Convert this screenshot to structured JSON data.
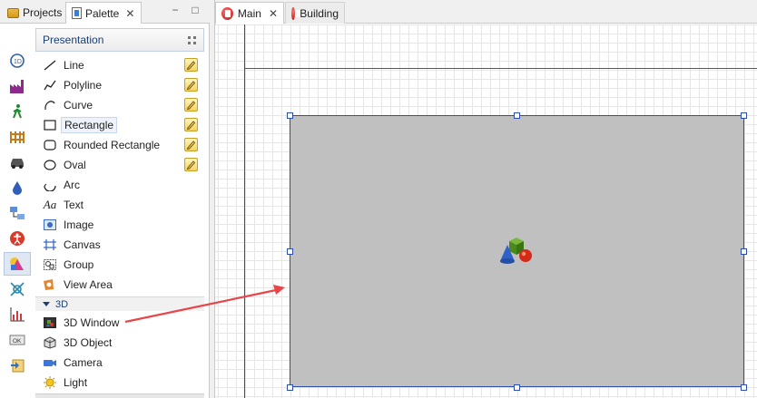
{
  "left_view": {
    "tabs": [
      {
        "label": "Projects",
        "icon": "projects-icon"
      },
      {
        "label": "Palette",
        "icon": "palette-icon",
        "close": "✕"
      }
    ],
    "minimize": "−",
    "maximize": "□"
  },
  "categories": [
    {
      "name": "statechart",
      "icon": "statechart-icon"
    },
    {
      "name": "process",
      "icon": "factory-icon"
    },
    {
      "name": "pedestrian",
      "icon": "walking-person-icon"
    },
    {
      "name": "rail",
      "icon": "rail-fence-icon"
    },
    {
      "name": "road",
      "icon": "car-icon"
    },
    {
      "name": "fluid",
      "icon": "droplet-icon"
    },
    {
      "name": "agent",
      "icon": "agent-icon"
    },
    {
      "name": "accessibility",
      "icon": "accessibility-icon"
    },
    {
      "name": "presentation",
      "icon": "shapes-icon",
      "selected": true
    },
    {
      "name": "connectivity",
      "icon": "connector-icon"
    },
    {
      "name": "analysis",
      "icon": "chart-icon"
    },
    {
      "name": "controls",
      "icon": "ok-button-icon",
      "text": "OK"
    },
    {
      "name": "export",
      "icon": "export-icon"
    }
  ],
  "palette": {
    "section": "Presentation",
    "items": [
      {
        "label": "Line",
        "editable": true
      },
      {
        "label": "Polyline",
        "editable": true
      },
      {
        "label": "Curve",
        "editable": true
      },
      {
        "label": "Rectangle",
        "editable": true
      },
      {
        "label": "Rounded Rectangle",
        "editable": true
      },
      {
        "label": "Oval",
        "editable": true
      },
      {
        "label": "Arc"
      },
      {
        "label": "Text",
        "icon_text": "Aa"
      },
      {
        "label": "Image"
      },
      {
        "label": "Canvas"
      },
      {
        "label": "Group"
      },
      {
        "label": "View Area"
      }
    ],
    "subsection": "3D",
    "items3d": [
      {
        "label": "3D Window"
      },
      {
        "label": "3D Object"
      },
      {
        "label": "Camera"
      },
      {
        "label": "Light"
      }
    ]
  },
  "editor": {
    "tabs": [
      {
        "label": "Main",
        "close": "✕",
        "icon": "agent-type-icon"
      },
      {
        "label": "Building",
        "icon": "agent-type-icon"
      }
    ]
  },
  "colors": {
    "window3d_fill": "#c0c0c0",
    "selection": "#2c4ea8",
    "arrow": "#e8464a"
  }
}
